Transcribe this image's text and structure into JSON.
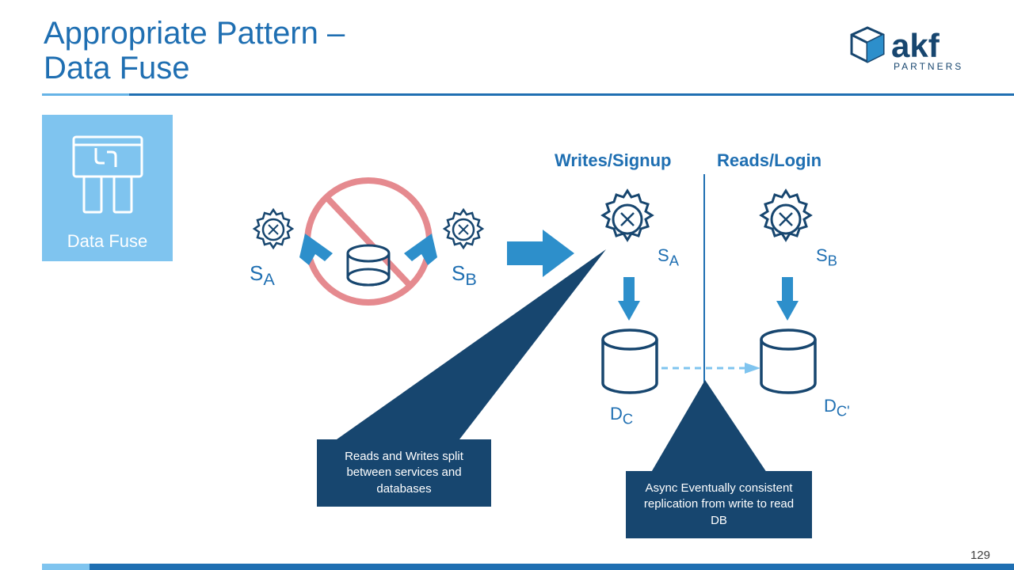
{
  "title_line1": "Appropriate Pattern –",
  "title_line2": "Data Fuse",
  "tile_label": "Data Fuse",
  "logo_main": "akf",
  "logo_sub": "PARTNERS",
  "heading_left": "Writes/Signup",
  "heading_right": "Reads/Login",
  "service_a": "S",
  "service_a_sub": "A",
  "service_b": "S",
  "service_b_sub": "B",
  "db_c": "D",
  "db_c_sub": "C",
  "db_cprime": "D",
  "db_cprime_sub": "C'",
  "annotation_left": "Reads and Writes split between services and databases",
  "annotation_right": "Async Eventually consistent replication from write to read DB",
  "page_number": "129"
}
